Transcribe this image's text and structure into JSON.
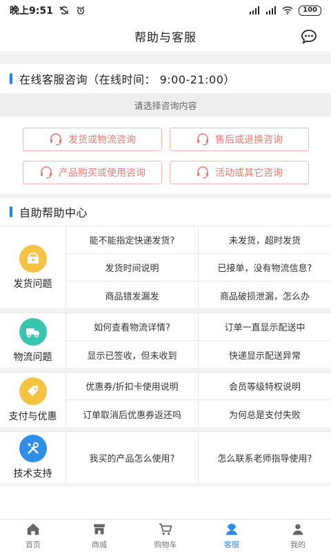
{
  "status": {
    "time": "晚上9:51",
    "battery": "100"
  },
  "nav": {
    "title": "帮助与客服"
  },
  "online": {
    "title": "在线客服咨询（在线时间： 9:00-21:00）",
    "prompt": "请选择咨询内容",
    "buttons": [
      "发货或物流咨询",
      "售后或退换咨询",
      "产品购买或使用咨询",
      "活动或其它咨询"
    ]
  },
  "selfhelp": {
    "title": "自助帮助中心",
    "categories": [
      {
        "label": "发货问题",
        "color": "#f5c242",
        "questions": [
          "能不能指定快递发货?",
          "未发货，超时发货",
          "发货时间说明",
          "已接单，没有物流信息?",
          "商品错发漏发",
          "商品破损泄漏，怎么办"
        ]
      },
      {
        "label": "物流问题",
        "color": "#39c4b0",
        "questions": [
          "如何查看物流详情?",
          "订单一直显示配送中",
          "显示已签收，但未收到",
          "快递显示配送异常"
        ]
      },
      {
        "label": "支付与优惠",
        "color": "#f5c242",
        "questions": [
          "优惠券/折扣卡使用说明",
          "会员等级特权说明",
          "订单取消后优惠券返还吗",
          "为何总是支付失败"
        ]
      },
      {
        "label": "技术支持",
        "color": "#2f8fe8",
        "questions": [
          "我买的产品怎么使用?",
          "怎么联系老师指导使用?"
        ]
      }
    ]
  },
  "tabs": [
    {
      "label": "首页"
    },
    {
      "label": "商城"
    },
    {
      "label": "购物车"
    },
    {
      "label": "客服"
    },
    {
      "label": "我的"
    }
  ],
  "colors": {
    "accent": "#2a8ce8",
    "consult": "#e57d74"
  }
}
